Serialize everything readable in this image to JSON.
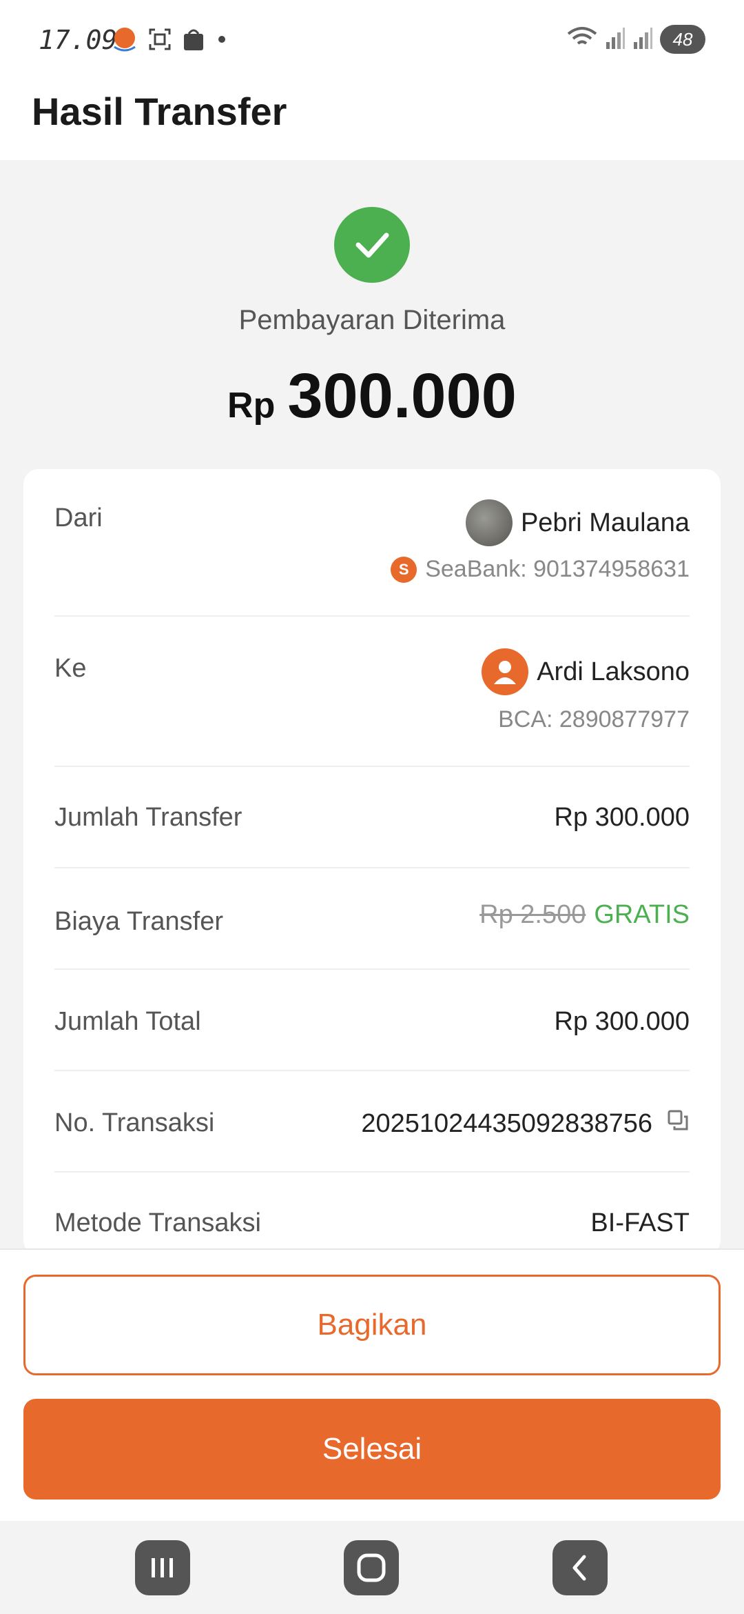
{
  "status_bar": {
    "time": "17.09",
    "battery": "48"
  },
  "header": {
    "title": "Hasil Transfer"
  },
  "hero": {
    "status": "Pembayaran Diterima",
    "currency": "Rp",
    "amount": "300.000"
  },
  "details": {
    "from": {
      "label": "Dari",
      "name": "Pebri Maulana",
      "bank_badge": "S",
      "account": "SeaBank: 901374958631"
    },
    "to": {
      "label": "Ke",
      "name": "Ardi Laksono",
      "account": "BCA: 2890877977"
    },
    "transfer_amount": {
      "label": "Jumlah Transfer",
      "value": "Rp 300.000"
    },
    "transfer_fee": {
      "label": "Biaya Transfer",
      "original": "Rp 2.500",
      "value": "GRATIS"
    },
    "total": {
      "label": "Jumlah Total",
      "value": "Rp 300.000"
    },
    "transaction_no": {
      "label": "No. Transaksi",
      "value": "20251024435092838756"
    },
    "method": {
      "label": "Metode Transaksi",
      "value": "BI-FAST"
    }
  },
  "actions": {
    "share": "Bagikan",
    "done": "Selesai"
  },
  "colors": {
    "accent": "#e8692c",
    "success": "#4caf50"
  }
}
